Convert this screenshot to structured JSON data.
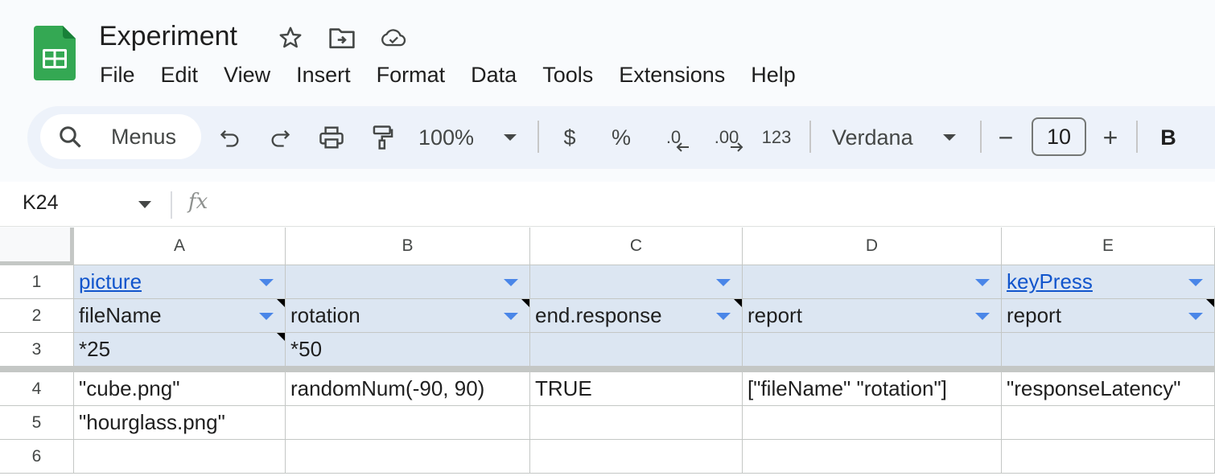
{
  "document": {
    "title": "Experiment"
  },
  "menu": [
    "File",
    "Edit",
    "View",
    "Insert",
    "Format",
    "Data",
    "Tools",
    "Extensions",
    "Help"
  ],
  "toolbar": {
    "search_label": "Menus",
    "zoom": "100%",
    "currency": "$",
    "percent": "%",
    "decrease_decimal": ".0",
    "increase_decimal": ".00",
    "number_format": "123",
    "font": "Verdana",
    "font_size": "10",
    "minus": "−",
    "plus": "+",
    "bold": "B"
  },
  "formula_bar": {
    "cell_ref": "K24",
    "fx": "fx",
    "value": ""
  },
  "columns": [
    "A",
    "B",
    "C",
    "D",
    "E"
  ],
  "rows": [
    "1",
    "2",
    "3",
    "4",
    "5",
    "6"
  ],
  "cells": {
    "A1": "picture",
    "B1": "",
    "C1": "",
    "D1": "",
    "E1": "keyPress",
    "A2": "fileName",
    "B2": "rotation",
    "C2": "end.response",
    "D2": "report",
    "E2": "report",
    "A3": "*25",
    "B3": "*50",
    "C3": "",
    "D3": "",
    "E3": "",
    "A4": "\"cube.png\"",
    "B4": "randomNum(-90, 90)",
    "C4": "TRUE",
    "D4": "[\"fileName\" \"rotation\"]",
    "E4": "\"responseLatency\"",
    "A5": "\"hourglass.png\"",
    "B5": "",
    "C5": "",
    "D5": "",
    "E5": "",
    "A6": "",
    "B6": "",
    "C6": "",
    "D6": "",
    "E6": ""
  },
  "colors": {
    "header_fill": "#dce6f2",
    "link": "#1155cc",
    "dropdown_arrow": "#4a86e8",
    "logo_green": "#34a853"
  }
}
